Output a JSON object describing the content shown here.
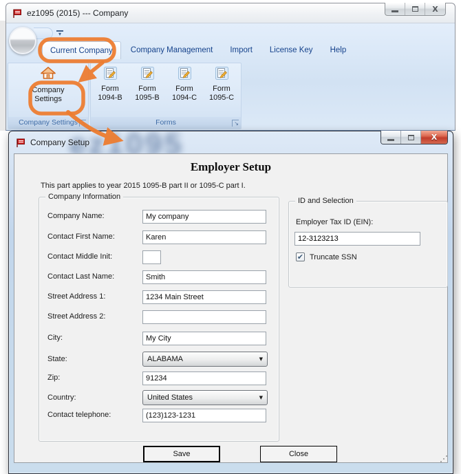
{
  "main_window": {
    "title": "ez1095 (2015) --- Company",
    "tabs": [
      {
        "label": "Current Company",
        "selected": true
      },
      {
        "label": "Company Management",
        "selected": false
      },
      {
        "label": "Import",
        "selected": false
      },
      {
        "label": "License Key",
        "selected": false
      },
      {
        "label": "Help",
        "selected": false
      }
    ],
    "ribbon": {
      "company_settings_button": {
        "line1": "Company",
        "line2": "Settings"
      },
      "forms_buttons": [
        {
          "line1": "Form",
          "line2": "1094-B"
        },
        {
          "line1": "Form",
          "line2": "1095-B"
        },
        {
          "line1": "Form",
          "line2": "1094-C"
        },
        {
          "line1": "Form",
          "line2": "1095-C"
        }
      ],
      "group_labels": {
        "company_settings": "Company Settings",
        "forms": "Forms"
      }
    }
  },
  "dialog": {
    "title": "Company Setup",
    "watermark": "ez1095",
    "heading": "Employer Setup",
    "note": "This part applies to year 2015 1095-B part II or 1095-C part I.",
    "company_information": {
      "group_label": "Company Information",
      "fields": [
        {
          "label": "Company Name:",
          "value": "My company",
          "type": "text"
        },
        {
          "label": "Contact First Name:",
          "value": "Karen",
          "type": "text"
        },
        {
          "label": "Contact Middle Init:",
          "value": "",
          "type": "small-text"
        },
        {
          "label": "Contact Last Name:",
          "value": "Smith",
          "type": "text"
        },
        {
          "label": "Street Address 1:",
          "value": "1234 Main Street",
          "type": "text"
        },
        {
          "label": "Street Address 2:",
          "value": "",
          "type": "text"
        },
        {
          "label": "City:",
          "value": "My City",
          "type": "text"
        },
        {
          "label": "State:",
          "value": "ALABAMA",
          "type": "combo"
        },
        {
          "label": "Zip:",
          "value": "91234",
          "type": "text"
        },
        {
          "label": "Country:",
          "value": "United States",
          "type": "combo"
        },
        {
          "label": "Contact telephone:",
          "value": "(123)123-1231",
          "type": "text"
        }
      ]
    },
    "id_and_selection": {
      "group_label": "ID and Selection",
      "ein_label": "Employer Tax ID (EIN):",
      "ein_value": "12-3123213",
      "truncate_ssn_label": "Truncate SSN",
      "truncate_ssn_checked": true
    },
    "buttons": {
      "save": "Save",
      "close": "Close"
    }
  },
  "colors": {
    "annotation_orange": "#ed7d31",
    "ribbon_tab_text": "#15428b",
    "group_label_text": "#3f6ca6",
    "dialog_close_red": "#c23d2c"
  }
}
